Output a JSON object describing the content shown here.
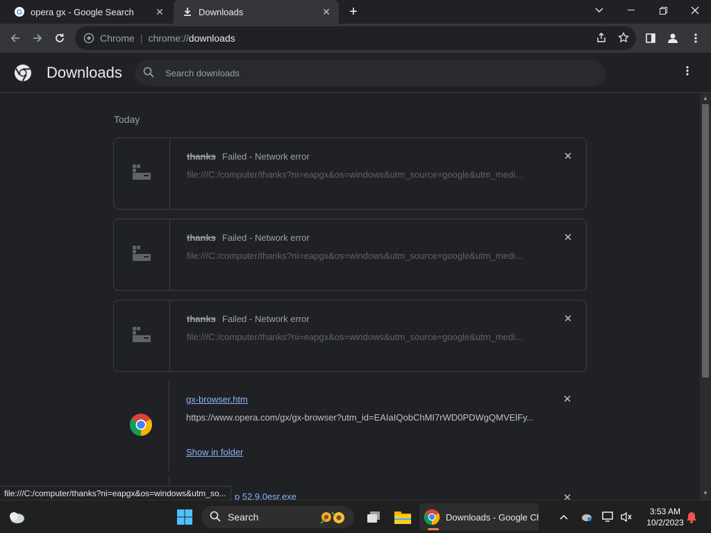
{
  "tabs": [
    {
      "title": "opera gx - Google Search",
      "icon": "google-icon"
    },
    {
      "title": "Downloads",
      "icon": "download-icon",
      "active": true
    }
  ],
  "toolbar": {
    "chip": "Chrome",
    "url_scheme": "chrome://",
    "url_path": "downloads"
  },
  "header": {
    "title": "Downloads",
    "search_placeholder": "Search downloads"
  },
  "section": {
    "label": "Today"
  },
  "downloads": [
    {
      "name": "thanks",
      "status": "Failed - Network error",
      "url": "file:///C:/computer/thanks?ni=eapgx&os=windows&utm_source=google&utm_medi..."
    },
    {
      "name": "thanks",
      "status": "Failed - Network error",
      "url": "file:///C:/computer/thanks?ni=eapgx&os=windows&utm_source=google&utm_medi..."
    },
    {
      "name": "thanks",
      "status": "Failed - Network error",
      "url": "file:///C:/computer/thanks?ni=eapgx&os=windows&utm_source=google&utm_medi..."
    },
    {
      "name": "gx-browser.htm",
      "url": "https://www.opera.com/gx/gx-browser?utm_id=EAIaIQobChMI7rWD0PDWgQMVElFy...",
      "action": "Show in folder"
    },
    {
      "name": "p 52.9.0esr.exe"
    }
  ],
  "statusbar": {
    "text": "file:///C:/computer/thanks?ni=eapgx&os=windows&utm_so..."
  },
  "taskbar": {
    "search_label": "Search",
    "chrome_label": "Downloads - Google Ch",
    "time": "3:53 AM",
    "date": "10/2/2023"
  },
  "colors": {
    "background": "#202124",
    "link": "#8ab4f8",
    "border": "#3c4043"
  }
}
